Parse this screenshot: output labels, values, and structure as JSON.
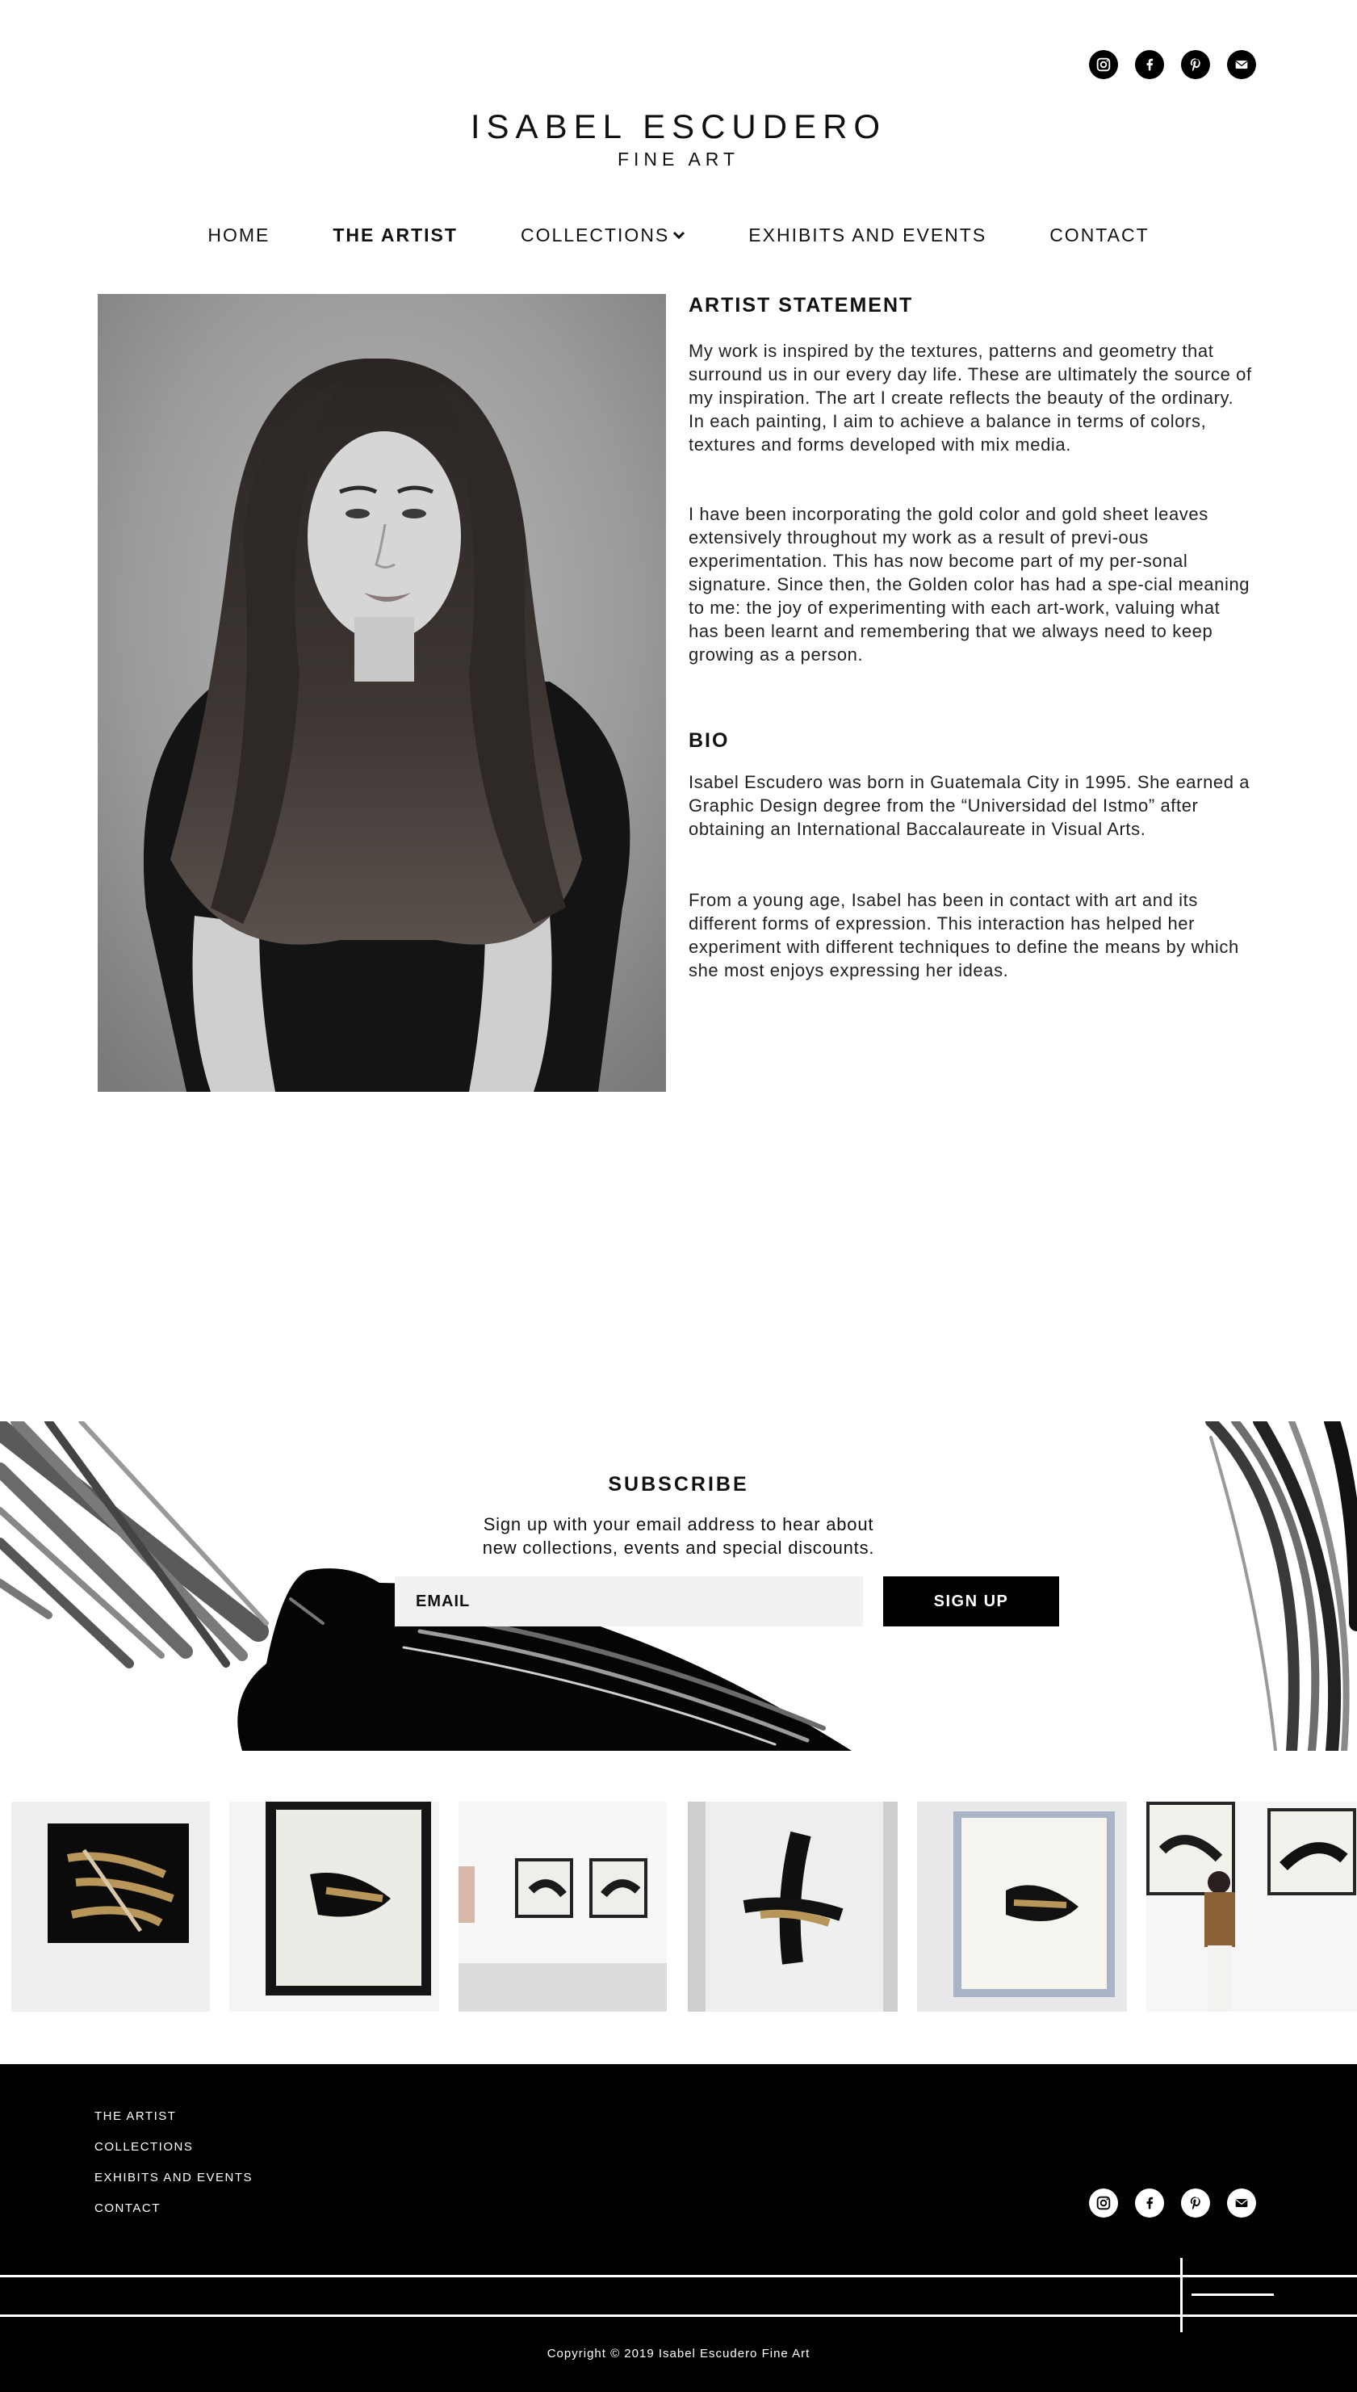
{
  "brand": {
    "name": "ISABEL ESCUDERO",
    "subtitle": "FINE ART"
  },
  "social": [
    "instagram-icon",
    "facebook-icon",
    "pinterest-icon",
    "mail-icon"
  ],
  "nav": {
    "home": "HOME",
    "artist": "THE ARTIST",
    "collections": "COLLECTIONS",
    "exhibits": "EXHIBITS AND EVENTS",
    "contact": "CONTACT"
  },
  "statement": {
    "title": "ARTIST STATEMENT",
    "p1": "My work is inspired by the textures, patterns and geometry that surround us in our every day life. These are ultimately the source of my inspiration. The art I create reflects the beauty of the ordinary. In each painting, I aim to achieve a balance in terms of colors, textures and forms developed with mix media.",
    "p2": "I have been incorporating the gold color and gold sheet leaves extensively throughout my work as a result of previ-ous experimentation. This has now become part of my per-sonal signature. Since then, the Golden color has had a spe-cial meaning to me: the joy of experimenting with each art-work, valuing what has been learnt and remembering that we always need to keep growing as a person."
  },
  "bio": {
    "title": "BIO",
    "p1": "Isabel Escudero was born in Guatemala City in 1995. She earned a Graphic Design degree from the “Universidad del Istmo” after obtaining an International Baccalaureate in Visual Arts.",
    "p2": "From a young age, Isabel has been in contact with art and its different forms of expression. This interaction has helped her experiment with different techniques to define the means by which she most enjoys expressing her ideas."
  },
  "subscribe": {
    "title": "SUBSCRIBE",
    "line1": "Sign up with your email address to hear about",
    "line2": "new collections, events and special discounts.",
    "placeholder": "EMAIL",
    "button": "SIGN UP"
  },
  "footer": {
    "links": [
      "THE ARTIST",
      "COLLECTIONS",
      "EXHIBITS AND EVENTS",
      "CONTACT"
    ],
    "copyright": "Copyright © 2019 Isabel Escudero Fine Art"
  },
  "colors": {
    "black": "#000000",
    "white": "#ffffff",
    "input_bg": "#f1f1f1",
    "gold": "#b8965a"
  }
}
